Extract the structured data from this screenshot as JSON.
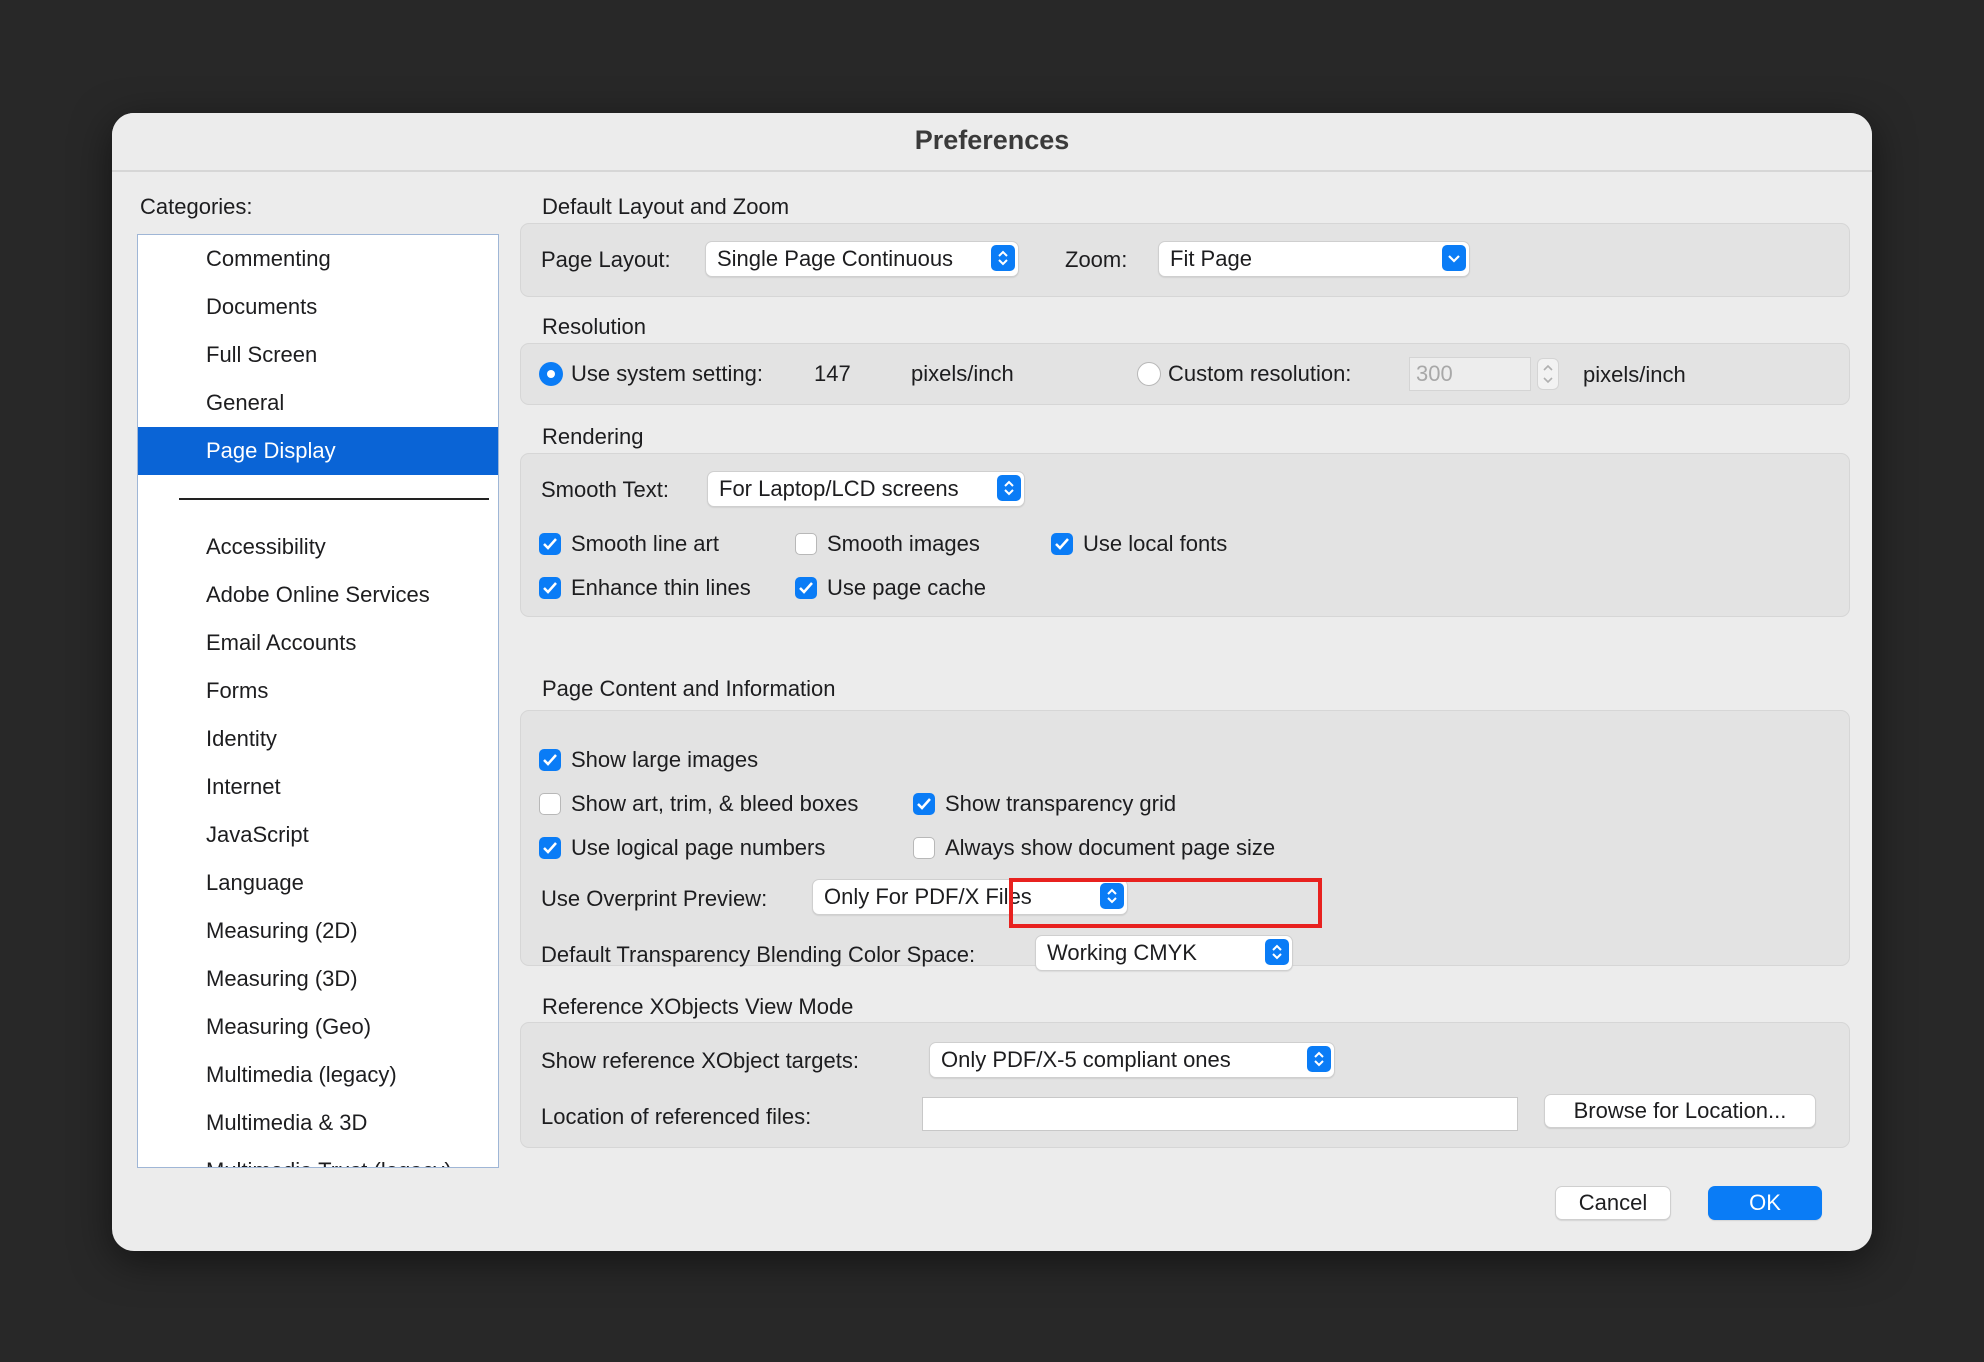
{
  "dialog": {
    "title": "Preferences"
  },
  "categories": {
    "label": "Categories:",
    "items": [
      "Commenting",
      "Documents",
      "Full Screen",
      "General",
      "Page Display",
      "Accessibility",
      "Adobe Online Services",
      "Email Accounts",
      "Forms",
      "Identity",
      "Internet",
      "JavaScript",
      "Language",
      "Measuring (2D)",
      "Measuring (3D)",
      "Measuring (Geo)",
      "Multimedia (legacy)",
      "Multimedia & 3D",
      "Multimedia Trust (legacy)"
    ],
    "selected": "Page Display"
  },
  "layout_zoom": {
    "heading": "Default Layout and Zoom",
    "page_layout_label": "Page Layout:",
    "page_layout_value": "Single Page Continuous",
    "zoom_label": "Zoom:",
    "zoom_value": "Fit Page"
  },
  "resolution": {
    "heading": "Resolution",
    "system_label": "Use system setting:",
    "system_value": "147",
    "system_unit": "pixels/inch",
    "system_selected": true,
    "custom_label": "Custom resolution:",
    "custom_value": "300",
    "custom_unit": "pixels/inch",
    "custom_selected": false
  },
  "rendering": {
    "heading": "Rendering",
    "smooth_text_label": "Smooth Text:",
    "smooth_text_value": "For Laptop/LCD screens",
    "smooth_line_art": {
      "label": "Smooth line art",
      "checked": true
    },
    "smooth_images": {
      "label": "Smooth images",
      "checked": false
    },
    "use_local_fonts": {
      "label": "Use local fonts",
      "checked": true
    },
    "enhance_thin_lines": {
      "label": "Enhance thin lines",
      "checked": true
    },
    "use_page_cache": {
      "label": "Use page cache",
      "checked": true
    }
  },
  "page_content": {
    "heading": "Page Content and Information",
    "show_large_images": {
      "label": "Show large images",
      "checked": true
    },
    "show_art_trim_bleed": {
      "label": "Show art, trim, & bleed boxes",
      "checked": false
    },
    "show_transparency_grid": {
      "label": "Show transparency grid",
      "checked": true
    },
    "use_logical_page_numbers": {
      "label": "Use logical page numbers",
      "checked": true
    },
    "always_show_page_size": {
      "label": "Always show document page size",
      "checked": false
    },
    "overprint_label": "Use Overprint Preview:",
    "overprint_value": "Only For PDF/X Files",
    "blending_label": "Default Transparency Blending Color Space:",
    "blending_value": "Working CMYK"
  },
  "xobjects": {
    "heading": "Reference XObjects View Mode",
    "targets_label": "Show reference XObject targets:",
    "targets_value": "Only PDF/X-5 compliant ones",
    "location_label": "Location of referenced files:",
    "location_value": "",
    "browse_label": "Browse for Location..."
  },
  "buttons": {
    "cancel": "Cancel",
    "ok": "OK"
  },
  "colors": {
    "accent": "#0a7cf6",
    "selection": "#0a64d6",
    "highlight": "#e8211f",
    "backdrop": "#282828"
  }
}
